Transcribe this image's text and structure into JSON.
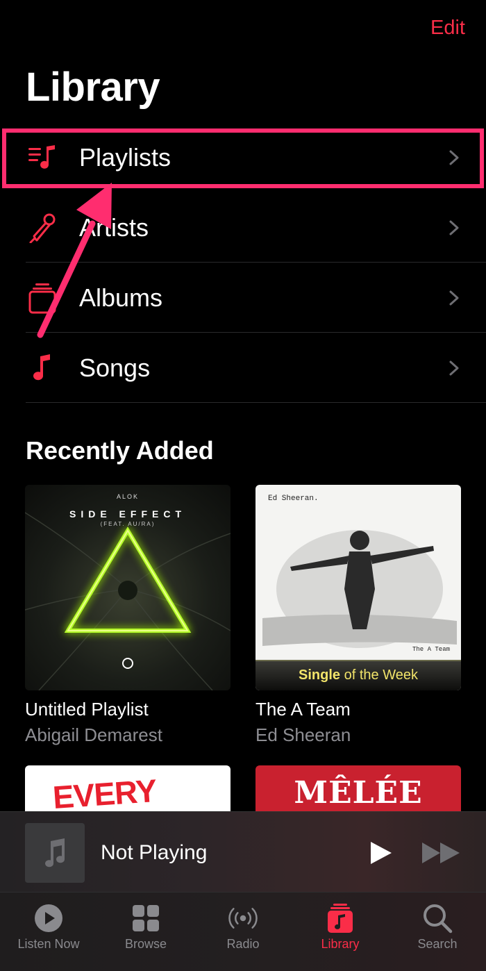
{
  "header": {
    "edit_label": "Edit",
    "title": "Library"
  },
  "nav": {
    "items": [
      {
        "label": "Playlists",
        "icon": "playlists-icon"
      },
      {
        "label": "Artists",
        "icon": "microphone-icon"
      },
      {
        "label": "Albums",
        "icon": "album-stack-icon"
      },
      {
        "label": "Songs",
        "icon": "music-note-icon"
      }
    ]
  },
  "recently_added": {
    "title": "Recently Added",
    "items": [
      {
        "title": "Untitled Playlist",
        "subtitle": "Abigail Demarest",
        "art": {
          "artist": "ALOK",
          "name": "SIDE EFFECT",
          "feat": "(FEAT. AU/RA)"
        }
      },
      {
        "title": "The A Team",
        "subtitle": "Ed Sheeran",
        "art": {
          "artist": "Ed Sheeran.",
          "name": "The A Team",
          "band_bold": "Single",
          "band_rest": " of the Week"
        }
      },
      {
        "title": "",
        "subtitle": "",
        "art": {
          "text": "EVERY"
        }
      },
      {
        "title": "",
        "subtitle": "",
        "art": {
          "text": "MÊLÉE"
        }
      }
    ]
  },
  "mini_player": {
    "title": "Not Playing"
  },
  "tabs": [
    {
      "label": "Listen Now",
      "icon": "play-circle-icon"
    },
    {
      "label": "Browse",
      "icon": "grid-icon"
    },
    {
      "label": "Radio",
      "icon": "radio-waves-icon"
    },
    {
      "label": "Library",
      "icon": "library-icon",
      "active": true
    },
    {
      "label": "Search",
      "icon": "magnifier-icon"
    }
  ],
  "colors": {
    "accent": "#fa2d48",
    "highlight": "#ff2d6f",
    "background": "#000000",
    "secondary_text": "#8e8e93"
  }
}
